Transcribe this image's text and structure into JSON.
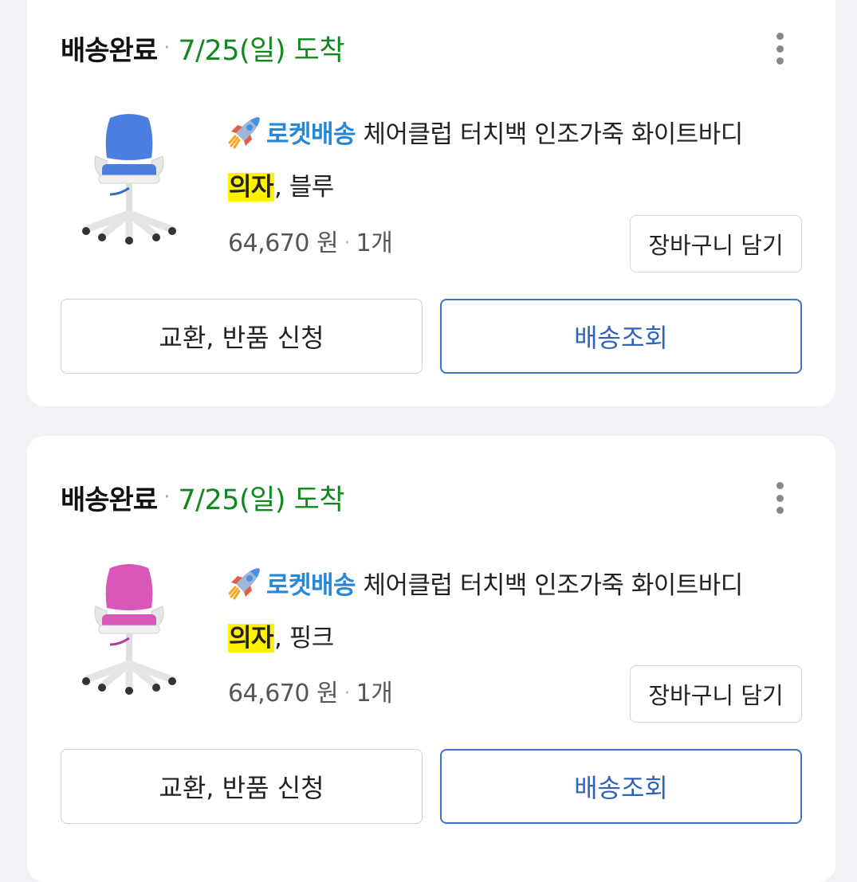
{
  "orders": [
    {
      "status": "배송완료",
      "separator": "·",
      "arrival": "7/25(일) 도착",
      "badge": "로켓배송",
      "title_part1": " 체어클럽 터치백 인조가죽 화이트바디",
      "title_highlight": "의자",
      "title_part2": ", 블루",
      "price": "64,670 원",
      "qty_separator": "·",
      "quantity": "1개",
      "cart_label": "장바구니 담기",
      "exchange_label": "교환, 반품 신청",
      "track_label": "배송조회",
      "thumb_color": "#4a7fe0",
      "thumb_icon": "office-chair-icon"
    },
    {
      "status": "배송완료",
      "separator": "·",
      "arrival": "7/25(일) 도착",
      "badge": "로켓배송",
      "title_part1": " 체어클럽 터치백 인조가죽 화이트바디",
      "title_highlight": "의자",
      "title_part2": ", 핑크",
      "price": "64,670 원",
      "qty_separator": "·",
      "quantity": "1개",
      "cart_label": "장바구니 담기",
      "exchange_label": "교환, 반품 신청",
      "track_label": "배송조회",
      "thumb_color": "#d957b8",
      "thumb_icon": "office-chair-icon"
    }
  ],
  "colors": {
    "arrival_green": "#11881f",
    "badge_blue": "#2787d8",
    "track_blue": "#2f63b8",
    "highlight": "#fff200"
  },
  "icons": {
    "rocket": "rocket-icon",
    "more": "more-vertical-icon"
  }
}
